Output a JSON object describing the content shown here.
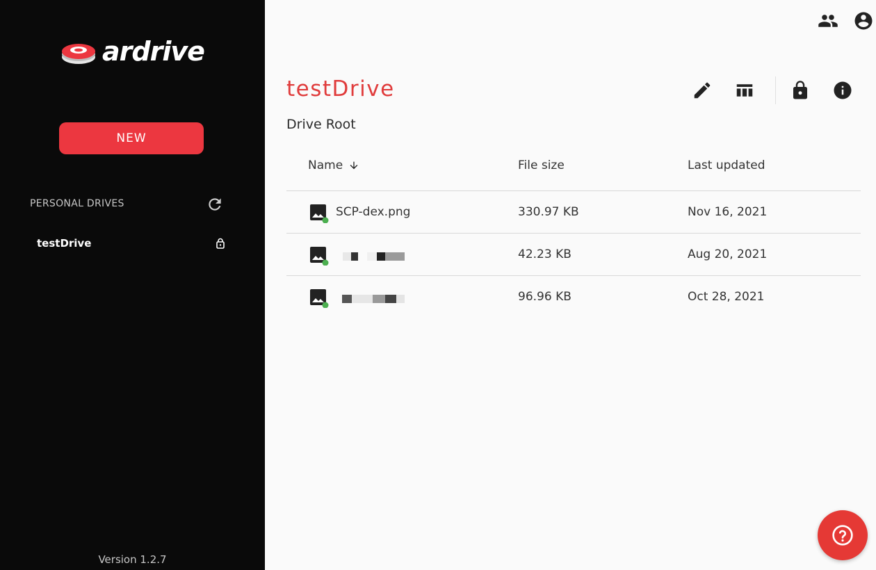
{
  "sidebar": {
    "logo_text": "ardrive",
    "new_button": "NEW",
    "section_title": "PERSONAL DRIVES",
    "drives": [
      {
        "label": "testDrive",
        "icon": "lock-icon"
      }
    ],
    "version": "Version 1.2.7"
  },
  "topbar": {
    "icons": [
      "people-icon",
      "account-icon"
    ]
  },
  "main": {
    "drive_title": "testDrive",
    "breadcrumb": "Drive Root",
    "actions": [
      "edit-icon",
      "view-column-icon",
      "lock-icon",
      "info-icon"
    ],
    "table": {
      "headers": {
        "name": "Name",
        "size": "File size",
        "updated": "Last updated"
      },
      "sort": "Name, descending",
      "rows": [
        {
          "name": "SCP-dex.png",
          "size": "330.97 KB",
          "updated": "Nov 16, 2021",
          "icon": "image-icon"
        },
        {
          "name": "",
          "size": "42.23 KB",
          "updated": "Aug 20, 2021",
          "icon": "image-icon"
        },
        {
          "name": "",
          "size": "96.96 KB",
          "updated": "Oct 28, 2021",
          "icon": "image-icon"
        }
      ]
    }
  },
  "help_button": {
    "icon": "help-icon"
  },
  "colors": {
    "brand_red": "#ec3740",
    "title_red": "#e03c3c",
    "sidebar_bg": "#0a0a0a",
    "sync_green": "#4caf50"
  }
}
